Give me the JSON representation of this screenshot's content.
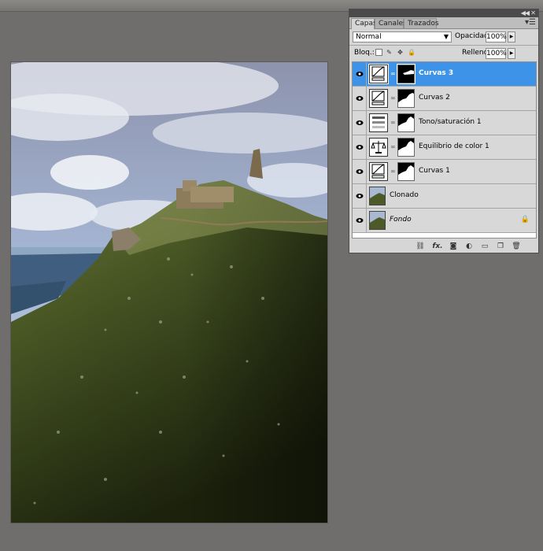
{
  "panel": {
    "tabs": [
      {
        "label": "Capas",
        "active": true
      },
      {
        "label": "Canales",
        "active": false
      },
      {
        "label": "Trazados",
        "active": false
      }
    ],
    "blend_mode": "Normal",
    "opacity_label": "Opacidad:",
    "opacity_value": "100%",
    "lock_label": "Bloq.:",
    "fill_label": "Relleno:",
    "fill_value": "100%",
    "layers": [
      {
        "name": "Curvas 3",
        "kind": "curves-adjustment",
        "selected": true,
        "visible": true
      },
      {
        "name": "Curvas 2",
        "kind": "curves-adjustment",
        "selected": false,
        "visible": true
      },
      {
        "name": "Tono/saturación 1",
        "kind": "hue-saturation-adjustment",
        "selected": false,
        "visible": true
      },
      {
        "name": "Equilibrio de color 1",
        "kind": "color-balance-adjustment",
        "selected": false,
        "visible": true
      },
      {
        "name": "Curvas 1",
        "kind": "curves-adjustment",
        "selected": false,
        "visible": true
      },
      {
        "name": "Clonado",
        "kind": "pixel-layer",
        "selected": false,
        "visible": true
      },
      {
        "name": "Fondo",
        "kind": "background-layer",
        "selected": false,
        "visible": true,
        "locked": true
      }
    ],
    "bottom_icons": [
      "link-layers-icon",
      "fx-icon",
      "add-mask-icon",
      "new-adjustment-icon",
      "new-group-icon",
      "new-layer-icon",
      "trash-icon"
    ],
    "fx_label": "fx."
  },
  "colors": {
    "workspace": "#6f6e6c",
    "panel": "#d6d6d6",
    "selection": "#3c93e8"
  }
}
